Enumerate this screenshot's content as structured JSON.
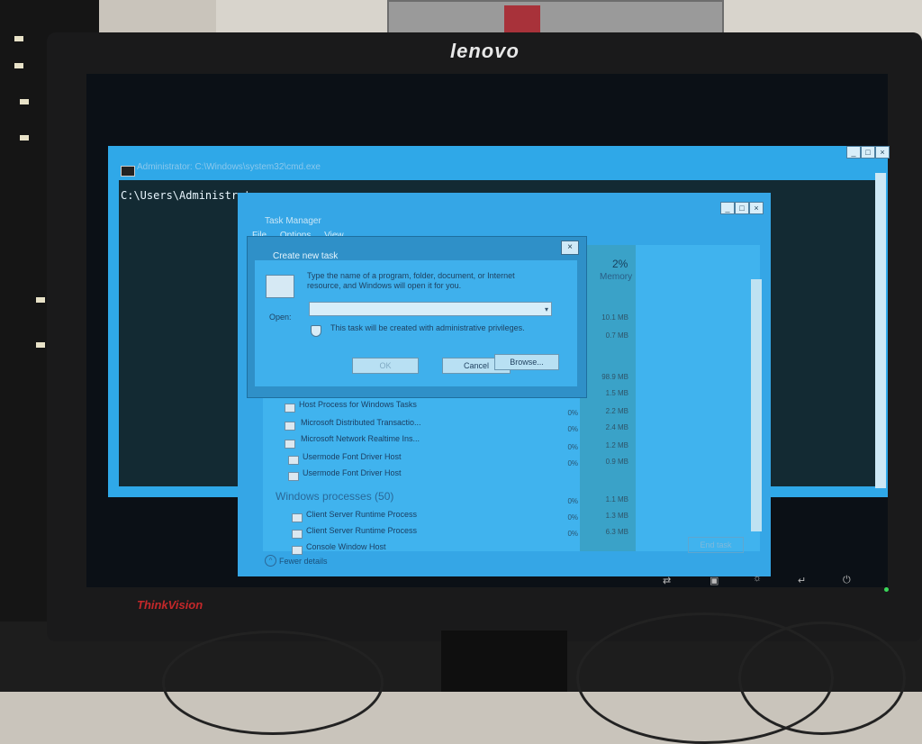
{
  "monitor": {
    "brand_top": "lenovo",
    "brand_bottom": "ThinkVision"
  },
  "cmd": {
    "title": "Administrator: C:\\Windows\\system32\\cmd.exe",
    "prompt": "C:\\Users\\Administrator>"
  },
  "task_manager": {
    "title": "Task Manager",
    "menu": [
      "File",
      "Options",
      "View"
    ],
    "memory_percent": "2%",
    "memory_label": "Memory",
    "visible_memory_values": [
      "10.1 MB",
      "0.7 MB",
      "98.9 MB"
    ],
    "rows": [
      {
        "name": "Host Process for Windows Tasks",
        "cpu": "0%",
        "memory": "1.5 MB"
      },
      {
        "name": "Microsoft Distributed Transactio...",
        "cpu": "0%",
        "memory": "2.2 MB"
      },
      {
        "name": "Microsoft Network Realtime Ins...",
        "cpu": "0%",
        "memory": "2.4 MB"
      },
      {
        "name": "Usermode Font Driver Host",
        "cpu": "0%",
        "memory": "1.2 MB"
      },
      {
        "name": "Usermode Font Driver Host",
        "cpu": "0%",
        "memory": "0.9 MB"
      }
    ],
    "group_heading": "Windows processes (50)",
    "group_rows": [
      {
        "name": "Client Server Runtime Process",
        "cpu": "0%",
        "memory": "1.1 MB"
      },
      {
        "name": "Client Server Runtime Process",
        "cpu": "0%",
        "memory": "1.3 MB"
      },
      {
        "name": "Console Window Host",
        "cpu": "0%",
        "memory": "6.3 MB"
      }
    ],
    "fewer_details": "Fewer details",
    "end_task": "End task"
  },
  "dialog": {
    "title": "Create new task",
    "description": "Type the name of a program, folder, document, or Internet resource, and Windows will open it for you.",
    "open_label": "Open:",
    "open_value": "",
    "admin_note": "This task will be created with administrative privileges.",
    "ok": "OK",
    "cancel": "Cancel",
    "browse": "Browse..."
  },
  "icons": [
    "cmd-icon",
    "app-icon",
    "shield-icon",
    "process-icon",
    "chevron-up-icon",
    "close-icon",
    "minimize-icon",
    "maximize-icon",
    "power-icon"
  ],
  "colors": {
    "screen_tint": "#35a6e6",
    "thinkvision_red": "#c4282a",
    "power_led": "#39d85a"
  }
}
